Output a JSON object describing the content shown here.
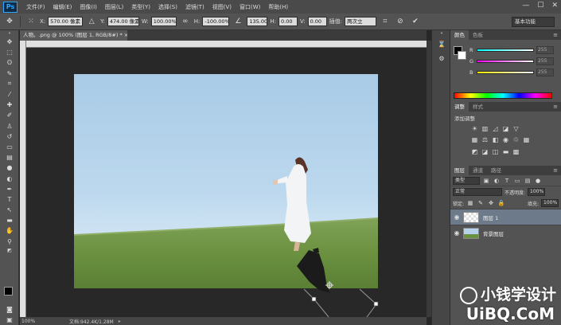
{
  "app": {
    "logo": "Ps"
  },
  "menu": [
    "文件(F)",
    "编辑(E)",
    "图像(I)",
    "图层(L)",
    "类型(Y)",
    "选择(S)",
    "滤镜(T)",
    "视图(V)",
    "窗口(W)",
    "帮助(H)"
  ],
  "window_controls": [
    "—",
    "☐",
    "✕"
  ],
  "options": {
    "x_label": "X:",
    "x_value": "570.00 像素",
    "y_label": "Y:",
    "y_value": "474.00 像素",
    "w_label": "W:",
    "w_value": "100.00%",
    "h_label": "H:",
    "h_value": "-100.00%",
    "angle_value": "135.00",
    "hskew_label": "H:",
    "hskew_value": "0.00",
    "vskew_label": "V:",
    "vskew_value": "0.00",
    "interp_label": "插值:",
    "interp_value": "两次立",
    "workspace": "基本功能"
  },
  "document": {
    "tab_title": "人物。.png @ 100% (图层 1, RGB/8#) * ×"
  },
  "status": {
    "zoom": "100%",
    "doc_info": "文档:942.4K/1.28M"
  },
  "panels": {
    "color_tabs": [
      "颜色",
      "色板"
    ],
    "sliders": [
      {
        "label": "R",
        "value": "255"
      },
      {
        "label": "G",
        "value": "255"
      },
      {
        "label": "B",
        "value": "255"
      }
    ],
    "adjust_tabs": [
      "调整",
      "样式"
    ],
    "adjust_title": "添加调整",
    "layers_tabs": [
      "图层",
      "通道",
      "路径"
    ],
    "kind_label": "类型",
    "blend_mode": "正常",
    "opacity_label": "不透明度:",
    "opacity_value": "100%",
    "lock_label": "锁定:",
    "fill_label": "填充:",
    "fill_value": "100%",
    "layers": [
      {
        "name": "图层 1",
        "selected": true
      },
      {
        "name": "背景图层",
        "selected": false
      }
    ]
  },
  "watermark": {
    "text": "小钱学设计",
    "site": "UiBQ.CoM"
  }
}
